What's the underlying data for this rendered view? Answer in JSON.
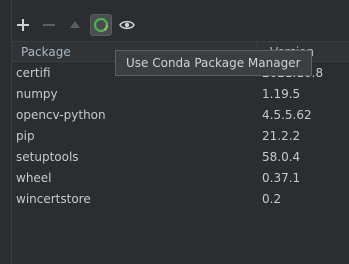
{
  "toolbar": {
    "add_icon": "plus-icon",
    "remove_icon": "minus-icon",
    "upgrade_icon": "triangle-up-icon",
    "conda_icon": "conda-ring-icon",
    "show_icon": "eye-icon"
  },
  "tooltip": {
    "text": "Use Conda Package Manager"
  },
  "table": {
    "headers": {
      "package": "Package",
      "version": "Version"
    },
    "rows": [
      {
        "name": "certifi",
        "version": "2021.10.8"
      },
      {
        "name": "numpy",
        "version": "1.19.5"
      },
      {
        "name": "opencv-python",
        "version": "4.5.5.62"
      },
      {
        "name": "pip",
        "version": "21.2.2"
      },
      {
        "name": "setuptools",
        "version": "58.0.4"
      },
      {
        "name": "wheel",
        "version": "0.37.1"
      },
      {
        "name": "wincertstore",
        "version": "0.2"
      }
    ]
  },
  "colors": {
    "background": "#2b2d30",
    "conda_green": "#4caf50"
  }
}
